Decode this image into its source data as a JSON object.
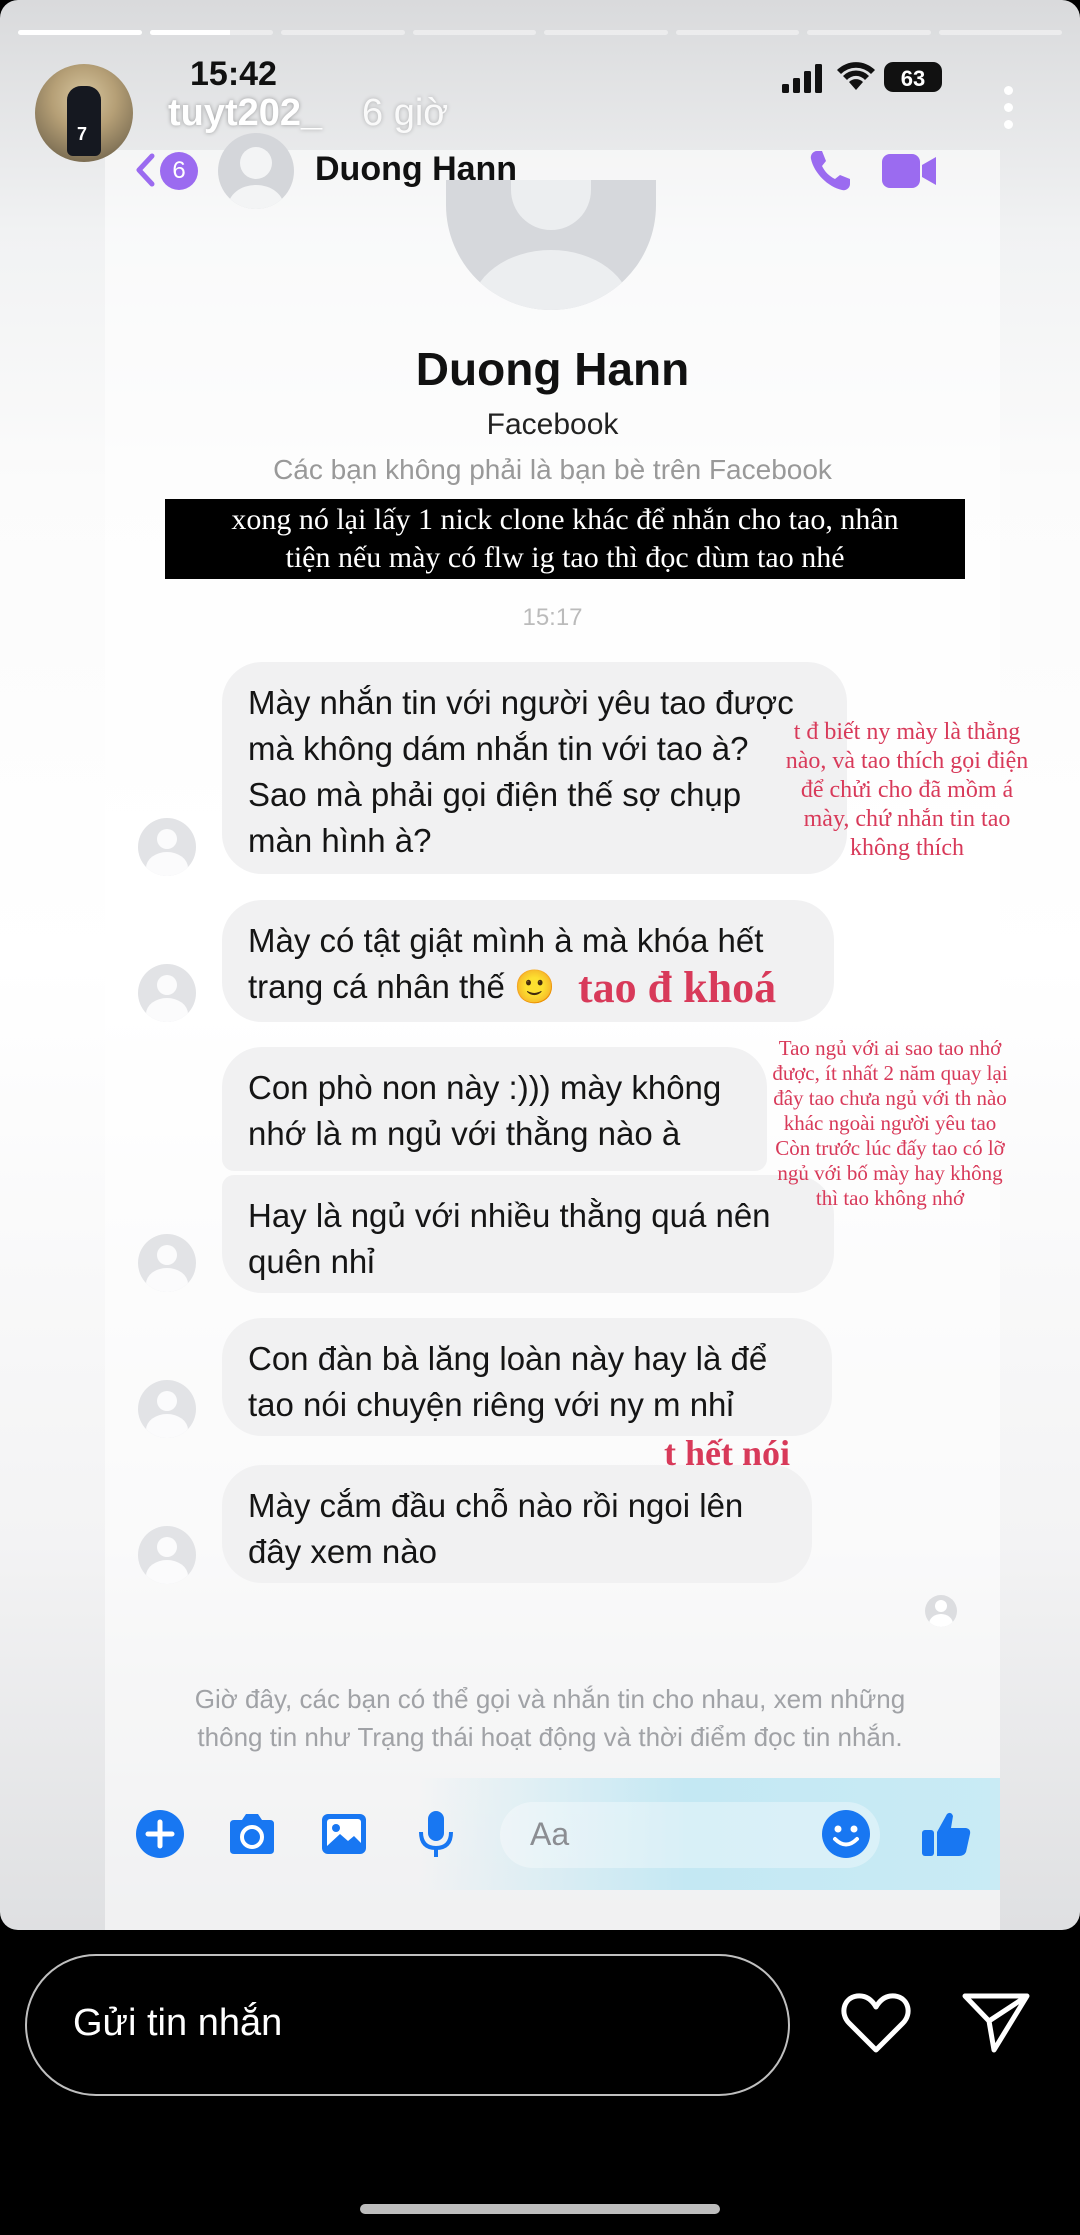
{
  "story": {
    "progress": [
      1,
      0.65,
      0,
      0,
      0,
      0,
      0,
      0
    ],
    "username": "tuyt202_",
    "age": "6 giờ",
    "avatar_number": "7"
  },
  "status_bar": {
    "time": "15:42",
    "battery": "63"
  },
  "messenger": {
    "header": {
      "back_badge": "6",
      "contact_name": "Duong Hann"
    },
    "profile": {
      "name": "Duong Hann",
      "source": "Facebook",
      "note": "Các bạn không phải là bạn bè trên Facebook"
    },
    "caption_line1": "xong nó lại lấy 1 nick clone khác để nhắn cho tao, nhân",
    "caption_line2": "tiện nếu mày có flw ig tao thì đọc dùm tao nhé",
    "timestamp": "15:17",
    "messages": [
      {
        "line1": "Mày nhắn tin với người yêu tao được",
        "line2": "mà không dám nhắn tin với tao à?",
        "line3": "Sao mà phải gọi điện thế sợ chụp",
        "line4": "màn hình à?"
      },
      {
        "line1": "Mày có tật giật mình à mà khóa hết",
        "line2": "trang cá nhân thế"
      },
      {
        "line1": "Con phò non này :))) mày không",
        "line2": "nhớ là m ngủ với thằng nào à"
      },
      {
        "line1": "Hay là ngủ với nhiều thằng quá nên",
        "line2": "quên nhỉ"
      },
      {
        "line1": "Con đàn bà lăng loàn này hay là để",
        "line2": "tao nói chuyện riêng với ny m nhỉ"
      },
      {
        "line1": "Mày cắm đầu chỗ nào rồi ngoi lên",
        "line2": "đây xem nào"
      }
    ],
    "emoji": "🙂",
    "annotations": {
      "a1": [
        "t đ biết ny mày là thằng",
        "nào, và tao thích gọi điện",
        "để chửi cho đã mồm á",
        "mày, chứ nhắn tin tao",
        "không thích"
      ],
      "a2": "tao đ khoá",
      "a3": [
        "Tao ngủ với ai sao tao nhớ",
        "được, ít nhất 2 năm quay lại",
        "đây tao chưa ngủ với th nào",
        "khác ngoài người yêu tao",
        "Còn trước lúc đấy tao có lỡ",
        "ngủ với bố mày hay không",
        "thì tao không nhớ"
      ],
      "a4": "t hết nói"
    },
    "info_line1": "Giờ đây, các bạn có thể gọi và nhắn tin cho nhau, xem những",
    "info_line2": "thông tin như Trạng thái hoạt động và thời điểm đọc tin nhắn.",
    "composer_placeholder": "Aa"
  },
  "reply": {
    "placeholder": "Gửi tin nhắn"
  },
  "colors": {
    "messenger_purple": "#9b6bf0",
    "messenger_blue": "#1877f2",
    "annotation_red": "#d83a5a"
  }
}
